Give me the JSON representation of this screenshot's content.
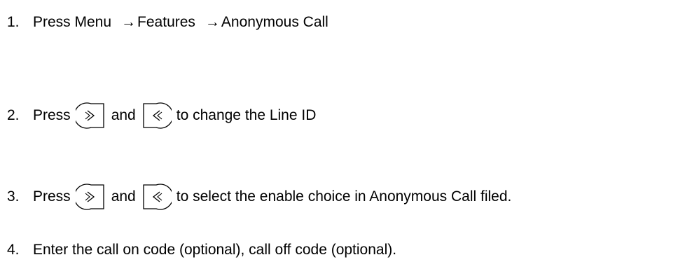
{
  "steps": [
    {
      "number": "1.",
      "text_before": "Press Menu",
      "arrow_1": "→",
      "part_2": "Features",
      "arrow_2": "→",
      "part_3": "Anonymous Call"
    },
    {
      "number": "2.",
      "text_before": "Press",
      "key_right_icon": "right-key-icon",
      "connector": "and",
      "key_left_icon": "left-key-icon",
      "text_after": "to change the Line ID"
    },
    {
      "number": "3.",
      "text_before": "Press",
      "key_right_icon": "right-key-icon",
      "connector": "and",
      "key_left_icon": "left-key-icon",
      "text_after": "to select the enable choice in Anonymous Call filed."
    },
    {
      "number": "4.",
      "text": "Enter the call on code (optional), call off code (optional)."
    }
  ]
}
